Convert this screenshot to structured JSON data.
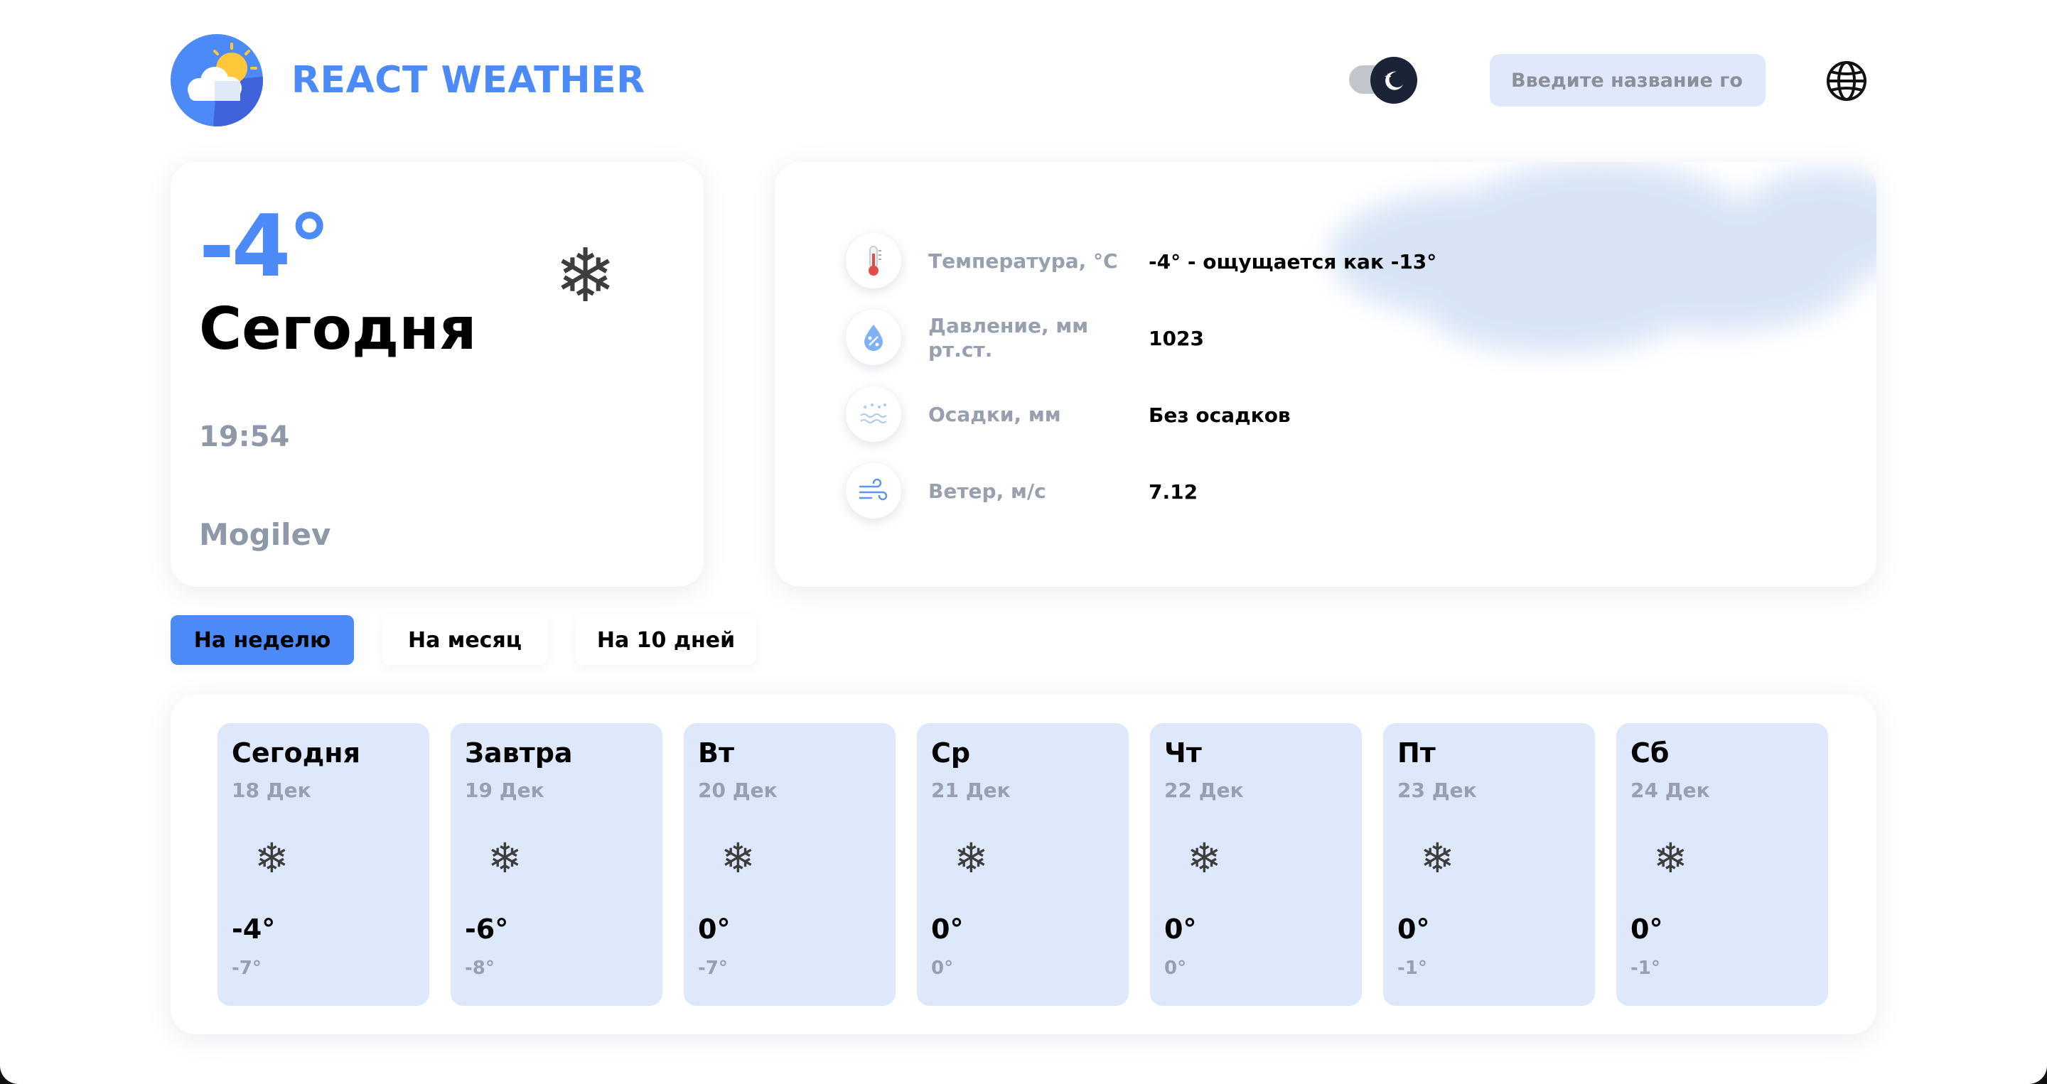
{
  "header": {
    "brand": "REACT WEATHER",
    "search_placeholder": "Введите название города"
  },
  "today": {
    "temp": "-4°",
    "title": "Сегодня",
    "icon": "snowflake-icon",
    "time": "19:54",
    "city": "Mogilev"
  },
  "details": {
    "rows": [
      {
        "icon": "thermometer-icon",
        "label": "Температура, °C",
        "value": "-4° - ощущается как -13°"
      },
      {
        "icon": "pressure-icon",
        "label": "Давление, мм рт.ст.",
        "value": "1023"
      },
      {
        "icon": "precipitation-icon",
        "label": "Осадки, мм",
        "value": "Без осадков"
      },
      {
        "icon": "wind-icon",
        "label": "Ветер, м/с",
        "value": "7.12"
      }
    ]
  },
  "tabs": [
    {
      "label": "На неделю",
      "active": true
    },
    {
      "label": "На месяц",
      "active": false
    },
    {
      "label": "На 10 дней",
      "active": false
    }
  ],
  "forecast": [
    {
      "day": "Сегодня",
      "date": "18 Дек",
      "icon": "snowflake-icon",
      "max": "-4°",
      "min": "-7°"
    },
    {
      "day": "Завтра",
      "date": "19 Дек",
      "icon": "snowflake-icon",
      "max": "-6°",
      "min": "-8°"
    },
    {
      "day": "Вт",
      "date": "20 Дек",
      "icon": "snowflake-icon",
      "max": "0°",
      "min": "-7°"
    },
    {
      "day": "Ср",
      "date": "21 Дек",
      "icon": "snowflake-icon",
      "max": "0°",
      "min": "0°"
    },
    {
      "day": "Чт",
      "date": "22 Дек",
      "icon": "snowflake-icon",
      "max": "0°",
      "min": "0°"
    },
    {
      "day": "Пт",
      "date": "23 Дек",
      "icon": "snowflake-icon",
      "max": "0°",
      "min": "-1°"
    },
    {
      "day": "Сб",
      "date": "24 Дек",
      "icon": "snowflake-icon",
      "max": "0°",
      "min": "-1°"
    }
  ],
  "colors": {
    "accent": "#4c8af7",
    "day_card": "#dde8fb",
    "muted_text": "#98a0b0",
    "search_bg": "#e0e9fb"
  }
}
